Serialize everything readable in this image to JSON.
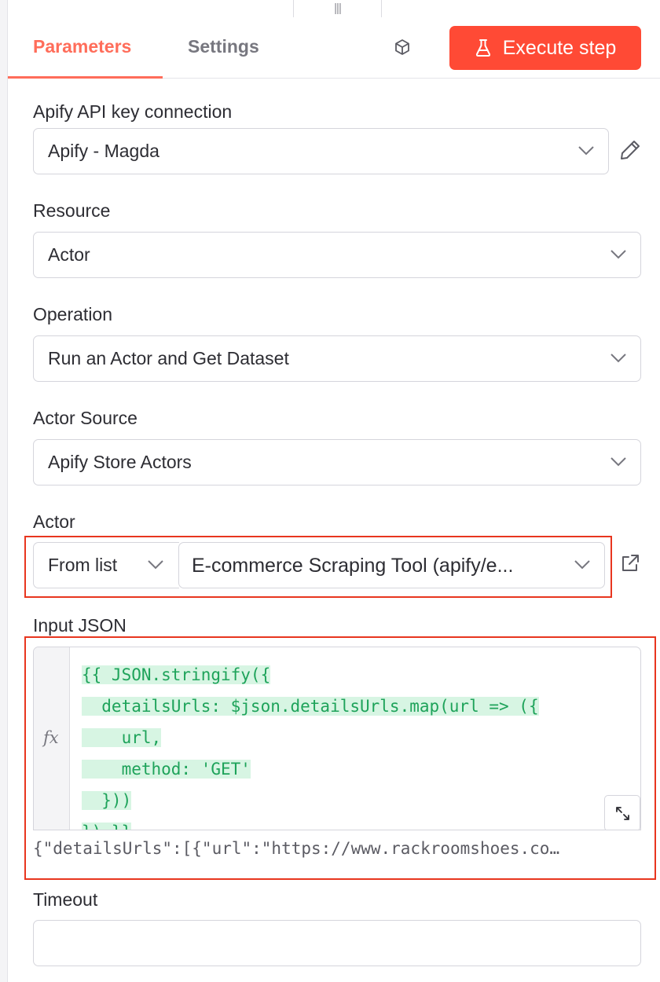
{
  "tabs": {
    "parameters": "Parameters",
    "settings": "Settings"
  },
  "execute_button": {
    "label": "Execute step",
    "color": "#ff4a35"
  },
  "accent_color": "#ff6d5a",
  "fields": {
    "connection": {
      "label": "Apify API key connection",
      "value": "Apify - Magda"
    },
    "resource": {
      "label": "Resource",
      "value": "Actor"
    },
    "operation": {
      "label": "Operation",
      "value": "Run an Actor and Get Dataset"
    },
    "actor_source": {
      "label": "Actor Source",
      "value": "Apify Store Actors"
    },
    "actor": {
      "label": "Actor",
      "mode": "From list",
      "value": "E-commerce Scraping Tool (apify/e..."
    },
    "input_json": {
      "label": "Input JSON",
      "fx": "fx",
      "lines": [
        "{{ JSON.stringify({",
        "  detailsUrls: $json.detailsUrls.map(url => ({",
        "    url,",
        "    method: 'GET'",
        "  }))",
        "}) }}"
      ],
      "preview": "{\"detailsUrls\":[{\"url\":\"https://www.rackroomshoes.co…"
    },
    "timeout": {
      "label": "Timeout",
      "value": ""
    }
  },
  "icons": [
    "drag-handle-icon",
    "cube-icon",
    "flask-icon",
    "chevron-down-icon",
    "pencil-icon",
    "external-link-icon",
    "expand-icon"
  ]
}
